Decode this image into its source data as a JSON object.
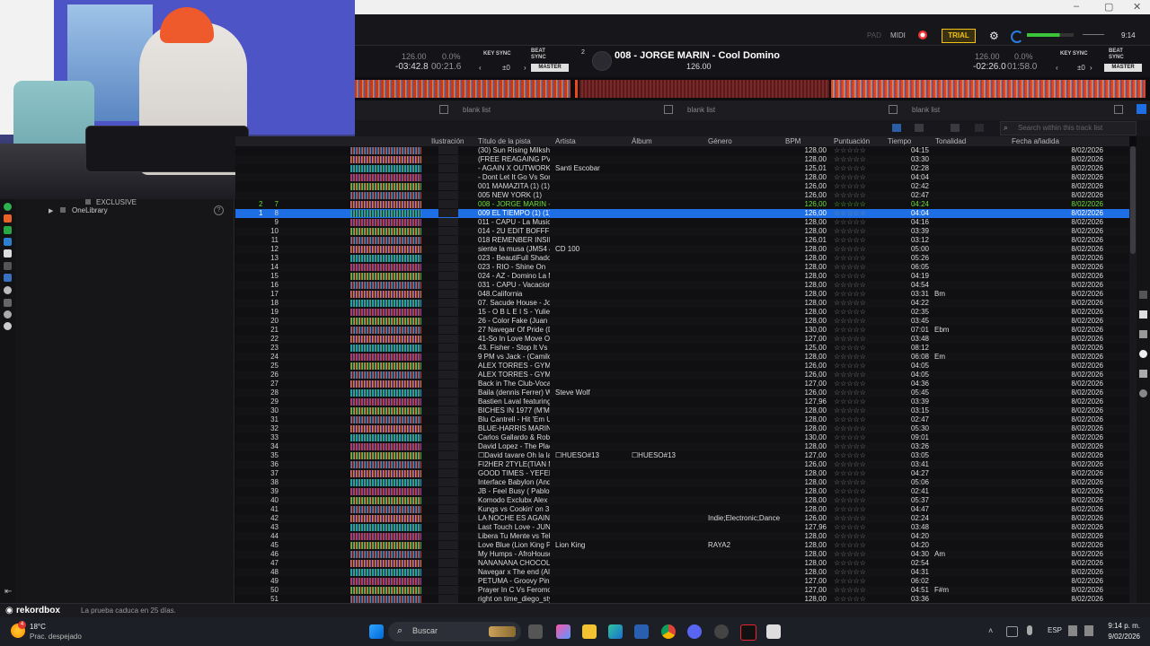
{
  "app": {
    "title_bar": {
      "minimize": "–",
      "maximize": "▢",
      "close": "✕"
    },
    "menubar": {
      "pad": "PAD",
      "midi": "MIDI",
      "trial": "TRIAL",
      "clock": "9:14"
    },
    "deck1": {
      "bpm": "126.00",
      "pitch": "0.0%",
      "remain": "-03:42.8",
      "elapsed": "00:21.6",
      "key_sync": "KEY SYNC",
      "beat_sync": "BEAT\nSYNC",
      "tempo": "±0",
      "master": "MASTER"
    },
    "deck2": {
      "number": "2",
      "title": "008 - JORGE MARIN - Cool Domino",
      "bpm_display": "126.00",
      "bpm": "126.00",
      "pitch": "0.0%",
      "remain": "-02:26.0",
      "elapsed": "01:58.0",
      "key_sync": "KEY SYNC",
      "beat_sync": "BEAT\nSYNC",
      "tempo": "±0",
      "master": "MASTER"
    },
    "panels": [
      "blank list",
      "blank list",
      "blank list"
    ],
    "search_placeholder": "Search within this track list",
    "columns": [
      "Ilustración",
      "Título de la pista",
      "Artista",
      "Álbum",
      "Género",
      "BPM",
      "Puntuación",
      "Tiempo",
      "Tonalidad",
      "Fecha añadida"
    ],
    "tree": {
      "exclusive": "EXCLUSIVE",
      "onelibrary": "OneLibrary",
      "help": "?"
    },
    "status": {
      "brand": "rekordbox",
      "trial_msg": "La prueba caduca en 25 días."
    },
    "rating_stars": "☆☆☆☆☆",
    "colors": {
      "accent": "#1e6fe6",
      "playing_green": "#6ede35",
      "trial": "#f2c318",
      "bg": "#101013"
    }
  },
  "tracks": [
    {
      "n": "",
      "title": "(30) Sun Rising Milksho",
      "artist": "",
      "album": "",
      "genre": "",
      "bpm": "128,00",
      "time": "04:15",
      "key": "",
      "date": "8/02/2026"
    },
    {
      "n": "",
      "title": "(FREE REAGAING PVT",
      "artist": "",
      "album": "",
      "genre": "",
      "bpm": "128,00",
      "time": "03:30",
      "key": "",
      "date": "8/02/2026"
    },
    {
      "n": "",
      "title": "- AGAIN X OUTWORK -",
      "artist": "Santi Escobar",
      "album": "",
      "genre": "",
      "bpm": "125,01",
      "time": "02:28",
      "key": "",
      "date": "8/02/2026"
    },
    {
      "n": "",
      "title": "- Dont Let It Go Vs Som",
      "artist": "",
      "album": "",
      "genre": "",
      "bpm": "128,00",
      "time": "04:04",
      "key": "",
      "date": "8/02/2026"
    },
    {
      "n": "",
      "title": "001 MAMAZITA (1) (1)",
      "artist": "",
      "album": "",
      "genre": "",
      "bpm": "126,00",
      "time": "02:42",
      "key": "",
      "date": "8/02/2026"
    },
    {
      "n": "",
      "title": "005 NEW YORK (1)",
      "artist": "",
      "album": "",
      "genre": "",
      "bpm": "126,00",
      "time": "02:47",
      "key": "",
      "date": "8/02/2026"
    },
    {
      "n": "7",
      "deck": "2",
      "title": "008 - JORGE MARIN -",
      "artist": "",
      "album": "",
      "genre": "",
      "bpm": "126,00",
      "time": "04:24",
      "key": "",
      "date": "8/02/2026",
      "state": "playing"
    },
    {
      "n": "8",
      "deck": "1",
      "title": "009 EL TIEMPO (1) (1)",
      "artist": "",
      "album": "",
      "genre": "",
      "bpm": "126,00",
      "time": "04:04",
      "key": "",
      "date": "8/02/2026",
      "state": "selected"
    },
    {
      "n": "9",
      "title": "011 - CAPU - La Musica",
      "artist": "",
      "album": "",
      "genre": "",
      "bpm": "128,00",
      "time": "04:16",
      "key": "",
      "date": "8/02/2026"
    },
    {
      "n": "10",
      "title": "014 - 2U EDIT BOFFFF",
      "artist": "",
      "album": "",
      "genre": "",
      "bpm": "128,00",
      "time": "03:39",
      "key": "",
      "date": "8/02/2026"
    },
    {
      "n": "11",
      "title": "018 REMENBER INSID",
      "artist": "",
      "album": "",
      "genre": "",
      "bpm": "126,01",
      "time": "03:12",
      "key": "",
      "date": "8/02/2026"
    },
    {
      "n": "12",
      "title": "siente la musa (JMS4 &",
      "artist": "CD 100",
      "album": "",
      "genre": "",
      "bpm": "128,00",
      "time": "05:00",
      "key": "",
      "date": "8/02/2026"
    },
    {
      "n": "13",
      "title": "023 - BeautiFull Shadow",
      "artist": "",
      "album": "",
      "genre": "",
      "bpm": "128,00",
      "time": "05:26",
      "key": "",
      "date": "8/02/2026"
    },
    {
      "n": "14",
      "title": "023 - RIO - Shine On",
      "artist": "",
      "album": "",
      "genre": "",
      "bpm": "128,00",
      "time": "06:05",
      "key": "",
      "date": "8/02/2026"
    },
    {
      "n": "15",
      "title": "024 - AZ - Domino La Mi",
      "artist": "",
      "album": "",
      "genre": "",
      "bpm": "128,00",
      "time": "04:19",
      "key": "",
      "date": "8/02/2026"
    },
    {
      "n": "16",
      "title": "031 - CAPU - Vacaciones",
      "artist": "",
      "album": "",
      "genre": "",
      "bpm": "128,00",
      "time": "04:54",
      "key": "",
      "date": "8/02/2026"
    },
    {
      "n": "17",
      "title": "048.California",
      "artist": "",
      "album": "",
      "genre": "",
      "bpm": "128,00",
      "time": "03:31",
      "key": "Bm",
      "date": "8/02/2026"
    },
    {
      "n": "18",
      "title": "07. Sacude House - Jorg",
      "artist": "",
      "album": "",
      "genre": "",
      "bpm": "128,00",
      "time": "04:22",
      "key": "",
      "date": "8/02/2026"
    },
    {
      "n": "19",
      "title": "15 - O B L E I S - Yulieth",
      "artist": "",
      "album": "",
      "genre": "",
      "bpm": "128,00",
      "time": "02:35",
      "key": "",
      "date": "8/02/2026"
    },
    {
      "n": "20",
      "title": "26 - Color Fake (Juan G",
      "artist": "",
      "album": "",
      "genre": "",
      "bpm": "128,00",
      "time": "03:45",
      "key": "",
      "date": "8/02/2026"
    },
    {
      "n": "21",
      "title": "27 Navegar Of Pride (Da",
      "artist": "",
      "album": "",
      "genre": "",
      "bpm": "130,00",
      "time": "07:01",
      "key": "Ebm",
      "date": "8/02/2026"
    },
    {
      "n": "22",
      "title": "41-So In Love Move On",
      "artist": "",
      "album": "",
      "genre": "",
      "bpm": "127,00",
      "time": "03:48",
      "key": "",
      "date": "8/02/2026"
    },
    {
      "n": "23",
      "title": "43. Fisher - Stop It Vs M",
      "artist": "",
      "album": "",
      "genre": "",
      "bpm": "125,00",
      "time": "08:12",
      "key": "",
      "date": "8/02/2026"
    },
    {
      "n": "24",
      "title": "9 PM vs Jack - (Camilo",
      "artist": "",
      "album": "",
      "genre": "",
      "bpm": "128,00",
      "time": "06:08",
      "key": "Em",
      "date": "8/02/2026"
    },
    {
      "n": "25",
      "title": "ALEX TORRES - GYM",
      "artist": "",
      "album": "",
      "genre": "",
      "bpm": "126,00",
      "time": "04:05",
      "key": "",
      "date": "8/02/2026"
    },
    {
      "n": "26",
      "title": "ALEX TORRES - GYM",
      "artist": "",
      "album": "",
      "genre": "",
      "bpm": "126,00",
      "time": "04:05",
      "key": "",
      "date": "8/02/2026"
    },
    {
      "n": "27",
      "title": "Back in The Club-Vocal",
      "artist": "",
      "album": "",
      "genre": "",
      "bpm": "127,00",
      "time": "04:36",
      "key": "",
      "date": "8/02/2026"
    },
    {
      "n": "28",
      "title": "Baila (dennis Ferrer) Wo",
      "artist": "Steve Wolf",
      "album": "",
      "genre": "",
      "bpm": "126,00",
      "time": "05:45",
      "key": "",
      "date": "8/02/2026"
    },
    {
      "n": "29",
      "title": "Bastien Laval featuring L",
      "artist": "",
      "album": "",
      "genre": "",
      "bpm": "127,96",
      "time": "03:39",
      "key": "",
      "date": "8/02/2026"
    },
    {
      "n": "30",
      "title": "BICHES IN 1977 (M'M)",
      "artist": "",
      "album": "",
      "genre": "",
      "bpm": "128,00",
      "time": "03:15",
      "key": "",
      "date": "8/02/2026"
    },
    {
      "n": "31",
      "title": "Blu Cantrell - Hit 'Em Up",
      "artist": "",
      "album": "",
      "genre": "",
      "bpm": "128,00",
      "time": "02:47",
      "key": "",
      "date": "8/02/2026"
    },
    {
      "n": "32",
      "title": "BLUE-HARRIS MARIN",
      "artist": "",
      "album": "",
      "genre": "",
      "bpm": "128,00",
      "time": "05:30",
      "key": "",
      "date": "8/02/2026"
    },
    {
      "n": "33",
      "title": "Carlos Gallardo & Robin",
      "artist": "",
      "album": "",
      "genre": "",
      "bpm": "130,00",
      "time": "09:01",
      "key": "",
      "date": "8/02/2026"
    },
    {
      "n": "34",
      "title": "David Lopez - The Place",
      "artist": "",
      "album": "",
      "genre": "",
      "bpm": "128,00",
      "time": "03:26",
      "key": "",
      "date": "8/02/2026"
    },
    {
      "n": "35",
      "title": "☐David tavare Oh la la",
      "artist": "☐HUESO#13",
      "album": "☐HUESO#13",
      "genre": "",
      "bpm": "127,00",
      "time": "03:05",
      "key": "",
      "date": "8/02/2026"
    },
    {
      "n": "36",
      "title": "FI2HER 2TYLE(TIAN M",
      "artist": "",
      "album": "",
      "genre": "",
      "bpm": "126,00",
      "time": "03:41",
      "key": "",
      "date": "8/02/2026"
    },
    {
      "n": "37",
      "title": "GOOD TIMES - YEFER",
      "artist": "",
      "album": "",
      "genre": "",
      "bpm": "128,00",
      "time": "04:27",
      "key": "",
      "date": "8/02/2026"
    },
    {
      "n": "38",
      "title": "Interface Babylon (Ander",
      "artist": "",
      "album": "",
      "genre": "",
      "bpm": "128,00",
      "time": "05:06",
      "key": "",
      "date": "8/02/2026"
    },
    {
      "n": "39",
      "title": "JB - Feel Busy ( Pablo V",
      "artist": "",
      "album": "",
      "genre": "",
      "bpm": "128,00",
      "time": "02:41",
      "key": "",
      "date": "8/02/2026"
    },
    {
      "n": "40",
      "title": "Komodo Exclubx Alex F",
      "artist": "",
      "album": "",
      "genre": "",
      "bpm": "128,00",
      "time": "05:37",
      "key": "",
      "date": "8/02/2026"
    },
    {
      "n": "41",
      "title": "Kungs vs Cookin' on 3",
      "artist": "",
      "album": "",
      "genre": "",
      "bpm": "128,00",
      "time": "04:47",
      "key": "",
      "date": "8/02/2026"
    },
    {
      "n": "42",
      "title": "LA NOCHE ES AGAIN E",
      "artist": "",
      "album": "",
      "genre": "Indie;Electronic;Dance;R",
      "bpm": "126,00",
      "time": "02:24",
      "key": "",
      "date": "8/02/2026"
    },
    {
      "n": "43",
      "title": "Last Touch Love - JUNI",
      "artist": "",
      "album": "",
      "genre": "",
      "bpm": "127,96",
      "time": "03:48",
      "key": "",
      "date": "8/02/2026"
    },
    {
      "n": "44",
      "title": "Libera Tu Mente vs Tekil",
      "artist": "",
      "album": "",
      "genre": "",
      "bpm": "128,00",
      "time": "04:20",
      "key": "",
      "date": "8/02/2026"
    },
    {
      "n": "45",
      "title": "Love Blue (Lion King Per",
      "artist": "Lion King",
      "album": "",
      "genre": "RAYA2",
      "bpm": "128,00",
      "time": "04:20",
      "key": "",
      "date": "8/02/2026"
    },
    {
      "n": "46",
      "title": "My Humps - AfroHouse",
      "artist": "",
      "album": "",
      "genre": "",
      "bpm": "128,00",
      "time": "04:30",
      "key": "Am",
      "date": "8/02/2026"
    },
    {
      "n": "47",
      "title": "NANANANA CHOCOLA",
      "artist": "",
      "album": "",
      "genre": "",
      "bpm": "128,00",
      "time": "02:54",
      "key": "",
      "date": "8/02/2026"
    },
    {
      "n": "48",
      "title": "Navegar x The end (Alex",
      "artist": "",
      "album": "",
      "genre": "",
      "bpm": "128,00",
      "time": "04:31",
      "key": "",
      "date": "8/02/2026"
    },
    {
      "n": "49",
      "title": "PETUMA - Groovy Pink",
      "artist": "",
      "album": "",
      "genre": "",
      "bpm": "127,00",
      "time": "06:02",
      "key": "",
      "date": "8/02/2026"
    },
    {
      "n": "50",
      "title": "Prayer In C Vs Feromon",
      "artist": "",
      "album": "",
      "genre": "",
      "bpm": "127,00",
      "time": "04:51",
      "key": "F#m",
      "date": "8/02/2026"
    },
    {
      "n": "51",
      "title": "right on time_diego_sty",
      "artist": "",
      "album": "",
      "genre": "",
      "bpm": "128,00",
      "time": "03:36",
      "key": "",
      "date": "8/02/2026"
    }
  ],
  "taskbar": {
    "weather_temp": "18°C",
    "weather_desc": "Prac. despejado",
    "weather_badge": "4",
    "search": "Buscar",
    "lang": "ESP",
    "time": "9:14 p. m.",
    "date": "9/02/2026"
  }
}
